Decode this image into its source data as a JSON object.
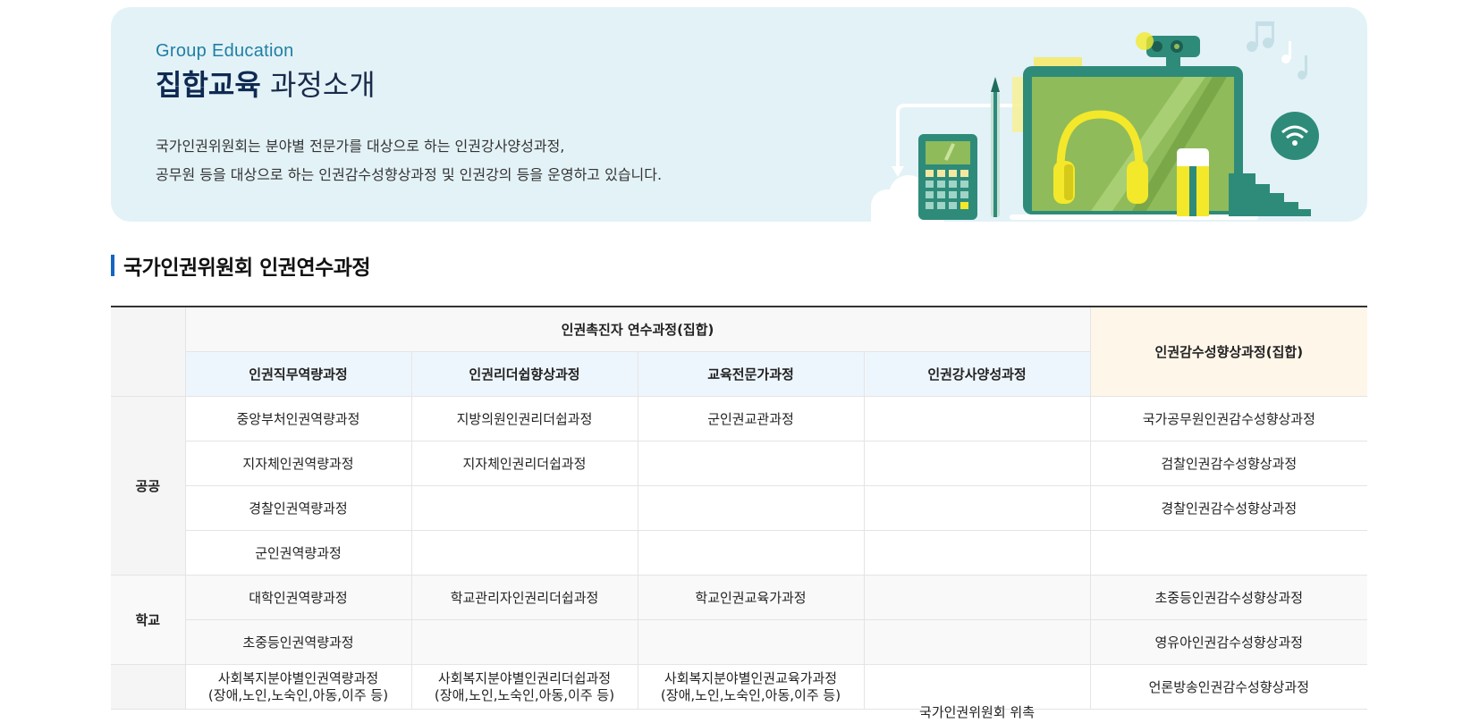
{
  "banner": {
    "subtitle": "Group Education",
    "title_strong": "집합교육",
    "title_light": "과정소개",
    "desc_line1": "국가인권위원회는 분야별 전문가를 대상으로 하는 인권강사양성과정,",
    "desc_line2": "공무원 등을 대상으로 하는 인권감수성향상과정 및 인권강의 등을 운영하고 있습니다."
  },
  "section": {
    "title": "국가인권위원회 인권연수과정"
  },
  "table": {
    "group_header": "인권촉진자 연수과정(집합)",
    "right_header": "인권감수성향상과정(집합)",
    "sub_headers": [
      "인권직무역량과정",
      "인권리더쉽향상과정",
      "교육전문가과정",
      "인권강사양성과정"
    ],
    "categories": {
      "public": "공공",
      "school": "학교"
    },
    "public_rows": [
      [
        "중앙부처인권역량과정",
        "지방의원인권리더쉽과정",
        "군인권교관과정",
        "",
        "국가공무원인권감수성향상과정"
      ],
      [
        "지자체인권역량과정",
        "지자체인권리더쉽과정",
        "",
        "",
        "검찰인권감수성향상과정"
      ],
      [
        "경찰인권역량과정",
        "",
        "",
        "",
        "경찰인권감수성향상과정"
      ],
      [
        "군인권역량과정",
        "",
        "",
        "",
        ""
      ]
    ],
    "school_rows": [
      [
        "대학인권역량과정",
        "학교관리자인권리더쉽과정",
        "학교인권교육가과정",
        "",
        "초중등인권감수성향상과정"
      ],
      [
        "초중등인권역량과정",
        "",
        "",
        "",
        "영유아인권감수성향상과정"
      ]
    ],
    "welfare_row": {
      "c1_line1": "사회복지분야별인권역량과정",
      "c1_line2": "(장애,노인,노숙인,아동,이주 등)",
      "c2_line1": "사회복지분야별인권리더쉽과정",
      "c2_line2": "(장애,노인,노숙인,아동,이주 등)",
      "c3_line1": "사회복지분야별인권교육가과정",
      "c3_line2": "(장애,노인,노숙인,아동,이주 등)",
      "c4": "국가인권위원회 위촉",
      "c5": "언론방송인권감수성향상과정"
    }
  },
  "colors": {
    "banner_bg": "#e3f2f7",
    "accent_blue": "#1565c0",
    "laptop_teal": "#2e8b7a",
    "screen_green": "#8fbb5a",
    "headphone_yellow": "#f4e82a"
  },
  "icons": [
    "calculator-icon",
    "pencil-icon",
    "laptop-icon",
    "headphones-icon",
    "webcam-icon",
    "wifi-icon",
    "music-notes-icon",
    "cloud-icon",
    "sticky-note-icon"
  ]
}
